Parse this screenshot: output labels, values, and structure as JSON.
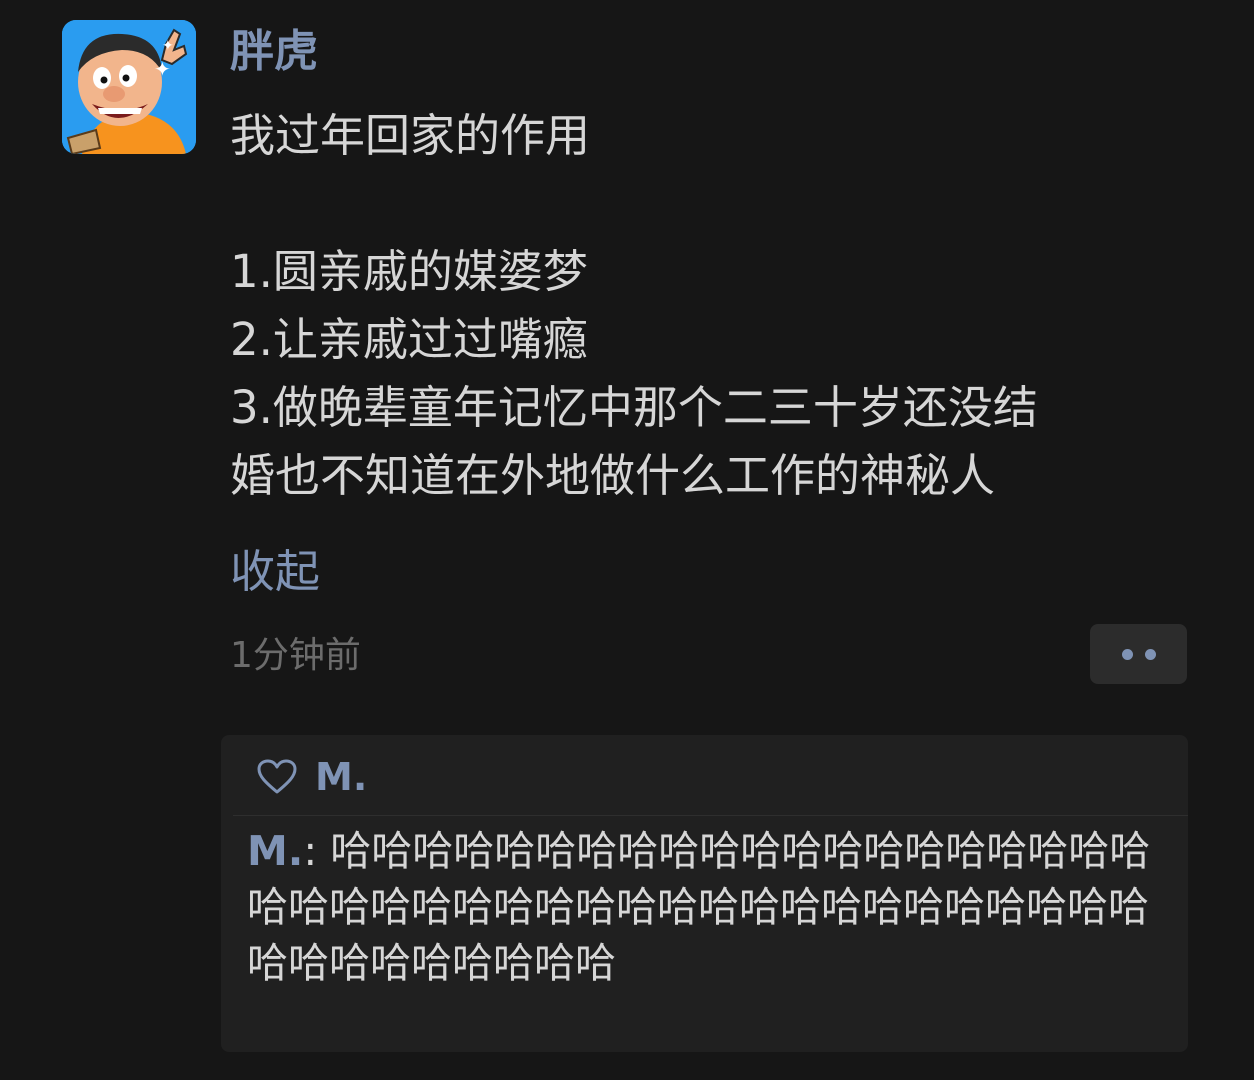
{
  "post": {
    "author": "胖虎",
    "avatar_icon": "cartoon-avatar-icon",
    "lines": [
      "我过年回家的作用",
      "",
      "1.圆亲戚的媒婆梦",
      "2.让亲戚过过嘴瘾",
      "3.做晚辈童年记忆中那个二三十岁还没结",
      "婚也不知道在外地做什么工作的神秘人"
    ],
    "collapse_label": "收起",
    "timestamp": "1分钟前"
  },
  "interaction": {
    "likes": {
      "icon": "heart-icon",
      "names": "M."
    },
    "comment": {
      "author": "M.",
      "separator": ": ",
      "text": "哈哈哈哈哈哈哈哈哈哈哈哈哈哈哈哈哈哈哈哈哈哈哈哈哈哈哈哈哈哈哈哈哈哈哈哈哈哈哈哈哈哈哈哈哈哈哈哈哈哈哈"
    }
  },
  "colors": {
    "background": "#161616",
    "link": "#7f93b5",
    "text": "#d6d6d6",
    "muted": "#6c6c6c",
    "panel": "#202020"
  }
}
